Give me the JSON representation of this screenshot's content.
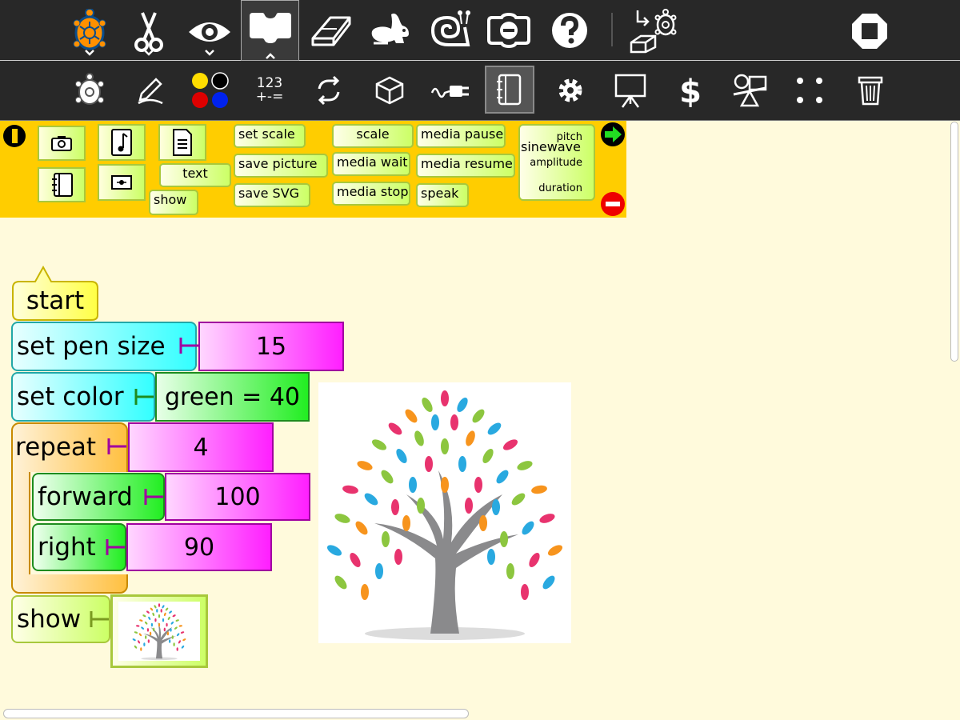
{
  "toolbar_main": {
    "items": [
      {
        "name": "turtle-icon"
      },
      {
        "name": "scissors-icon"
      },
      {
        "name": "eye-icon"
      },
      {
        "name": "blocks-tab-icon"
      },
      {
        "name": "eraser-icon"
      },
      {
        "name": "rabbit-icon"
      },
      {
        "name": "snail-icon"
      },
      {
        "name": "collapse-icon"
      },
      {
        "name": "help-icon"
      },
      {
        "name": "load-turtle-icon"
      },
      {
        "name": "stop-icon"
      }
    ]
  },
  "toolbar_palette": {
    "numbers_line1": "123",
    "numbers_line2": "+-=",
    "items": [
      "turtle-palette",
      "pen-palette",
      "colors-palette",
      "numbers-palette",
      "flow-palette",
      "blocks-palette",
      "sensors-palette",
      "media-palette",
      "extras-palette",
      "presentation-palette",
      "portfolio-palette",
      "sensors-dollar",
      "trash"
    ]
  },
  "palette": {
    "set_scale": "set scale",
    "scale": "scale",
    "media_pause": "media pause",
    "pitch": "pitch",
    "sinewave": "sinewave",
    "save_picture": "save picture",
    "media_wait": "media wait",
    "media_resume": "media resume",
    "amplitude": "amplitude",
    "text": "text",
    "save_svg": "save SVG",
    "media_stop": "media stop",
    "speak": "speak",
    "duration": "duration",
    "show": "show"
  },
  "program": {
    "start": "start",
    "set_pen_size": "set pen size",
    "pen_size_value": "15",
    "set_color": "set color",
    "color_value": "green = 40",
    "repeat": "repeat",
    "repeat_value": "4",
    "forward": "forward",
    "forward_value": "100",
    "right": "right",
    "right_value": "90",
    "show": "show"
  },
  "colors": {
    "toolbar_bg": "#282828",
    "palette_bg": "#ffcd00",
    "canvas_bg": "#fffadc",
    "start_block": "#ffff44",
    "pen_block": "#33ffff",
    "flow_block": "#ffc040",
    "turtle_block": "#22ee22",
    "number_block": "#ff1fff",
    "media_block": "#ccff66"
  }
}
